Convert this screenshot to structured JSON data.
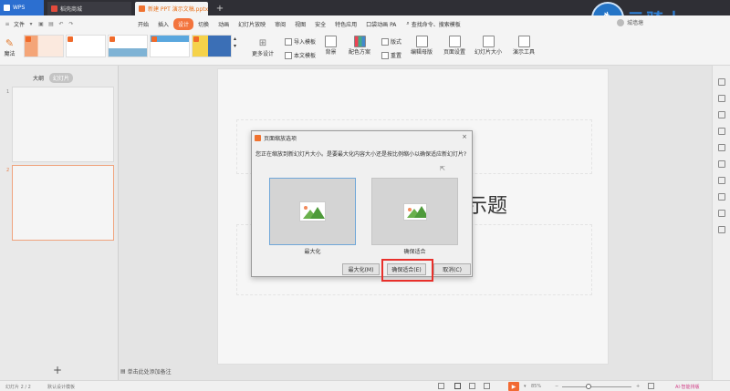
{
  "tabs": {
    "wps": "WPS",
    "store": "稻壳商城",
    "doc": "新建 PPT 演示文稿.pptx"
  },
  "brand": {
    "text": "云骑士"
  },
  "menubar": {
    "file": "文件",
    "items": [
      "开始",
      "插入",
      "设计",
      "切换",
      "动画",
      "幻灯片放映",
      "审阅",
      "视图",
      "安全",
      "特色应用",
      "口袋动画 PA"
    ],
    "active_index": 2,
    "search_placeholder": "查找命令、搜索模板",
    "user": "城墙塘"
  },
  "ribbon": {
    "magic": "魔法",
    "more_design": "更多设计",
    "import_template": "导入模板",
    "text_template": "本文模板",
    "background": "背景",
    "color_scheme": "配色方案",
    "format": "版式",
    "reset": "重置",
    "edit_master": "编辑母版",
    "page_setup": "页面设置",
    "slide_size": "幻灯片大小",
    "presentation_tools": "演示工具"
  },
  "leftpanel": {
    "tab_outline": "大纲",
    "tab_slides": "幻灯片",
    "slide1": "1",
    "slide2": "2",
    "add": "+"
  },
  "canvas": {
    "title": "添加标题",
    "title_visible": "示题"
  },
  "notes": "单击此处添加备注",
  "status": {
    "slide": "幻灯片 2 / 2",
    "theme": "默认设计模板",
    "zoom": "85%",
    "ai": "AI·智能排版"
  },
  "dialog": {
    "title": "页面缩放选项",
    "close": "×",
    "message": "您正在缩放到新幻灯片大小。是要最大化内容大小还是按比例缩小以确保适应新幻灯片?",
    "option_max": "最大化",
    "option_fit": "确保适合",
    "btn_max": "最大化(M)",
    "btn_fit": "确保适合(E)",
    "btn_cancel": "取消(C)"
  },
  "colors": {
    "accent": "#f3743d",
    "wps_blue": "#2c6fd0",
    "highlight_red": "#e8302b"
  }
}
